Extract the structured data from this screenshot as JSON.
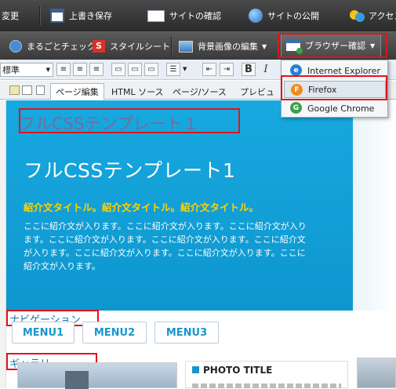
{
  "toolbar1": {
    "items": [
      {
        "label": "変更"
      },
      {
        "label": "上書き保存"
      },
      {
        "label": "サイトの確認"
      },
      {
        "label": "サイトの公開"
      },
      {
        "label": "アクセス"
      }
    ]
  },
  "toolbar2": {
    "items": [
      {
        "label": "まるごとチェック"
      },
      {
        "label": "スタイルシート"
      },
      {
        "label": "背景画像の編集"
      },
      {
        "label": "ブラウザー確認"
      }
    ]
  },
  "format": {
    "font_select": "標準",
    "bold": "B",
    "italic": "I"
  },
  "tabs": [
    {
      "label": "ページ編集"
    },
    {
      "label": "HTML ソース"
    },
    {
      "label": "ページ/ソース"
    },
    {
      "label": "プレビュ"
    }
  ],
  "dropdown": {
    "items": [
      {
        "label": "Internet Explorer",
        "icon": "ie-icon",
        "color": "#2a7fd4"
      },
      {
        "label": "Firefox",
        "icon": "firefox-icon",
        "color": "#f08a1c"
      },
      {
        "label": "Google Chrome",
        "icon": "chrome-icon",
        "color": "#3aa14a"
      }
    ]
  },
  "page": {
    "heading_label": "フルCSSテンプレート１",
    "hero_title": "フルCSSテンプレート1",
    "intro_title": "紹介文タイトル。紹介文タイトル。紹介文タイトル。",
    "intro_lines": [
      "ここに紹介文が入ります。ここに紹介文が入ります。ここに紹介文が入り",
      "ます。ここに紹介文が入ります。ここに紹介文が入ります。ここに紹介文",
      "が入ります。ここに紹介文が入ります。ここに紹介文が入ります。ここに",
      "紹介文が入ります。"
    ],
    "nav_label": "ナビゲーション",
    "menu": [
      "MENU1",
      "MENU2",
      "MENU3"
    ],
    "gallery_label": "ギャラリー",
    "photo_title": "PHOTO TITLE"
  },
  "colors": {
    "hero": "#13a3da",
    "intro_title": "#ffd200",
    "highlight": "#e0141b",
    "menu_text": "#1a95cc"
  }
}
